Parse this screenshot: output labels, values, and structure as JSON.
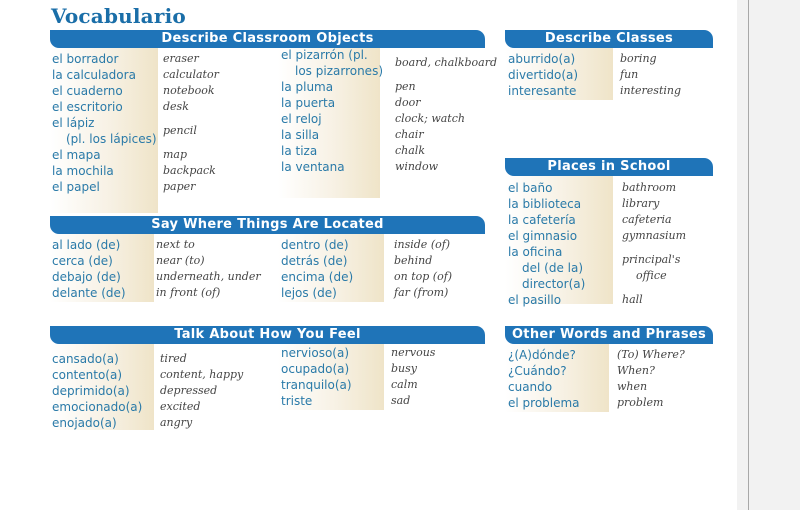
{
  "title": "Vocabulario",
  "sections": {
    "classroom": {
      "header": "Describe  Classroom  Objects",
      "col1": [
        {
          "term": "el borrador",
          "def": "eraser"
        },
        {
          "term": "la calculadora",
          "def": "calculator"
        },
        {
          "term": "el cuaderno",
          "def": "notebook"
        },
        {
          "term": "el escritorio",
          "def": "desk"
        },
        {
          "term": "el lápiz",
          "term2": "(pl. los lápices)",
          "def": "pencil"
        },
        {
          "term": "el mapa",
          "def": "map"
        },
        {
          "term": "la mochila",
          "def": "backpack"
        },
        {
          "term": "el papel",
          "def": "paper"
        }
      ],
      "col2": [
        {
          "term": "el pizarrón (pl.",
          "term2": "los pizarrones)",
          "def": "board, chalkboard"
        },
        {
          "term": "la pluma",
          "def": "pen"
        },
        {
          "term": "la puerta",
          "def": "door"
        },
        {
          "term": "el reloj",
          "def": "clock; watch"
        },
        {
          "term": "la silla",
          "def": "chair"
        },
        {
          "term": "la tiza",
          "def": "chalk"
        },
        {
          "term": "la ventana",
          "def": "window"
        }
      ]
    },
    "classes": {
      "header": "Describe Classes",
      "items": [
        {
          "term": "aburrido(a)",
          "def": "boring"
        },
        {
          "term": "divertido(a)",
          "def": "fun"
        },
        {
          "term": "interesante",
          "def": "interesting"
        }
      ]
    },
    "places": {
      "header": "Places in School",
      "items": [
        {
          "term": "el baño",
          "def": "bathroom"
        },
        {
          "term": "la biblioteca",
          "def": "library"
        },
        {
          "term": "la cafetería",
          "def": "cafeteria"
        },
        {
          "term": "el gimnasio",
          "def": "gymnasium"
        },
        {
          "term": "la oficina",
          "term2": "del (de la)",
          "term3": "director(a)",
          "def": "principal's",
          "def2": "office"
        },
        {
          "term": "el pasillo",
          "def": "hall"
        }
      ]
    },
    "location": {
      "header": "Say Where Things Are Located",
      "col1": [
        {
          "term": "al lado (de)",
          "def": "next to"
        },
        {
          "term": "cerca (de)",
          "def": "near (to)"
        },
        {
          "term": "debajo (de)",
          "def": "underneath, under"
        },
        {
          "term": "delante (de)",
          "def": "in front (of)"
        }
      ],
      "col2": [
        {
          "term": "dentro (de)",
          "def": "inside (of)"
        },
        {
          "term": "detrás (de)",
          "def": "behind"
        },
        {
          "term": "encima (de)",
          "def": "on top (of)"
        },
        {
          "term": "lejos (de)",
          "def": "far (from)"
        }
      ]
    },
    "feel": {
      "header": "Talk About How You Feel",
      "col1": [
        {
          "term": "cansado(a)",
          "def": "tired"
        },
        {
          "term": "contento(a)",
          "def": "content, happy"
        },
        {
          "term": "deprimido(a)",
          "def": "depressed"
        },
        {
          "term": "emocionado(a)",
          "def": "excited"
        },
        {
          "term": "enojado(a)",
          "def": "angry"
        }
      ],
      "col2": [
        {
          "term": "nervioso(a)",
          "def": "nervous"
        },
        {
          "term": "ocupado(a)",
          "def": "busy"
        },
        {
          "term": "tranquilo(a)",
          "def": "calm"
        },
        {
          "term": "triste",
          "def": "sad"
        }
      ]
    },
    "other": {
      "header": "Other Words and Phrases",
      "items": [
        {
          "term": "¿(A)dónde?",
          "def": "(To) Where?"
        },
        {
          "term": "¿Cuándo?",
          "def": "When?"
        },
        {
          "term": "cuando",
          "def": "when"
        },
        {
          "term": "el problema",
          "def": "problem"
        }
      ]
    }
  },
  "colors": {
    "title": "#1a6ea8",
    "header_bg": "#1f74b8",
    "term": "#2a7aa8",
    "definition": "#444444"
  }
}
